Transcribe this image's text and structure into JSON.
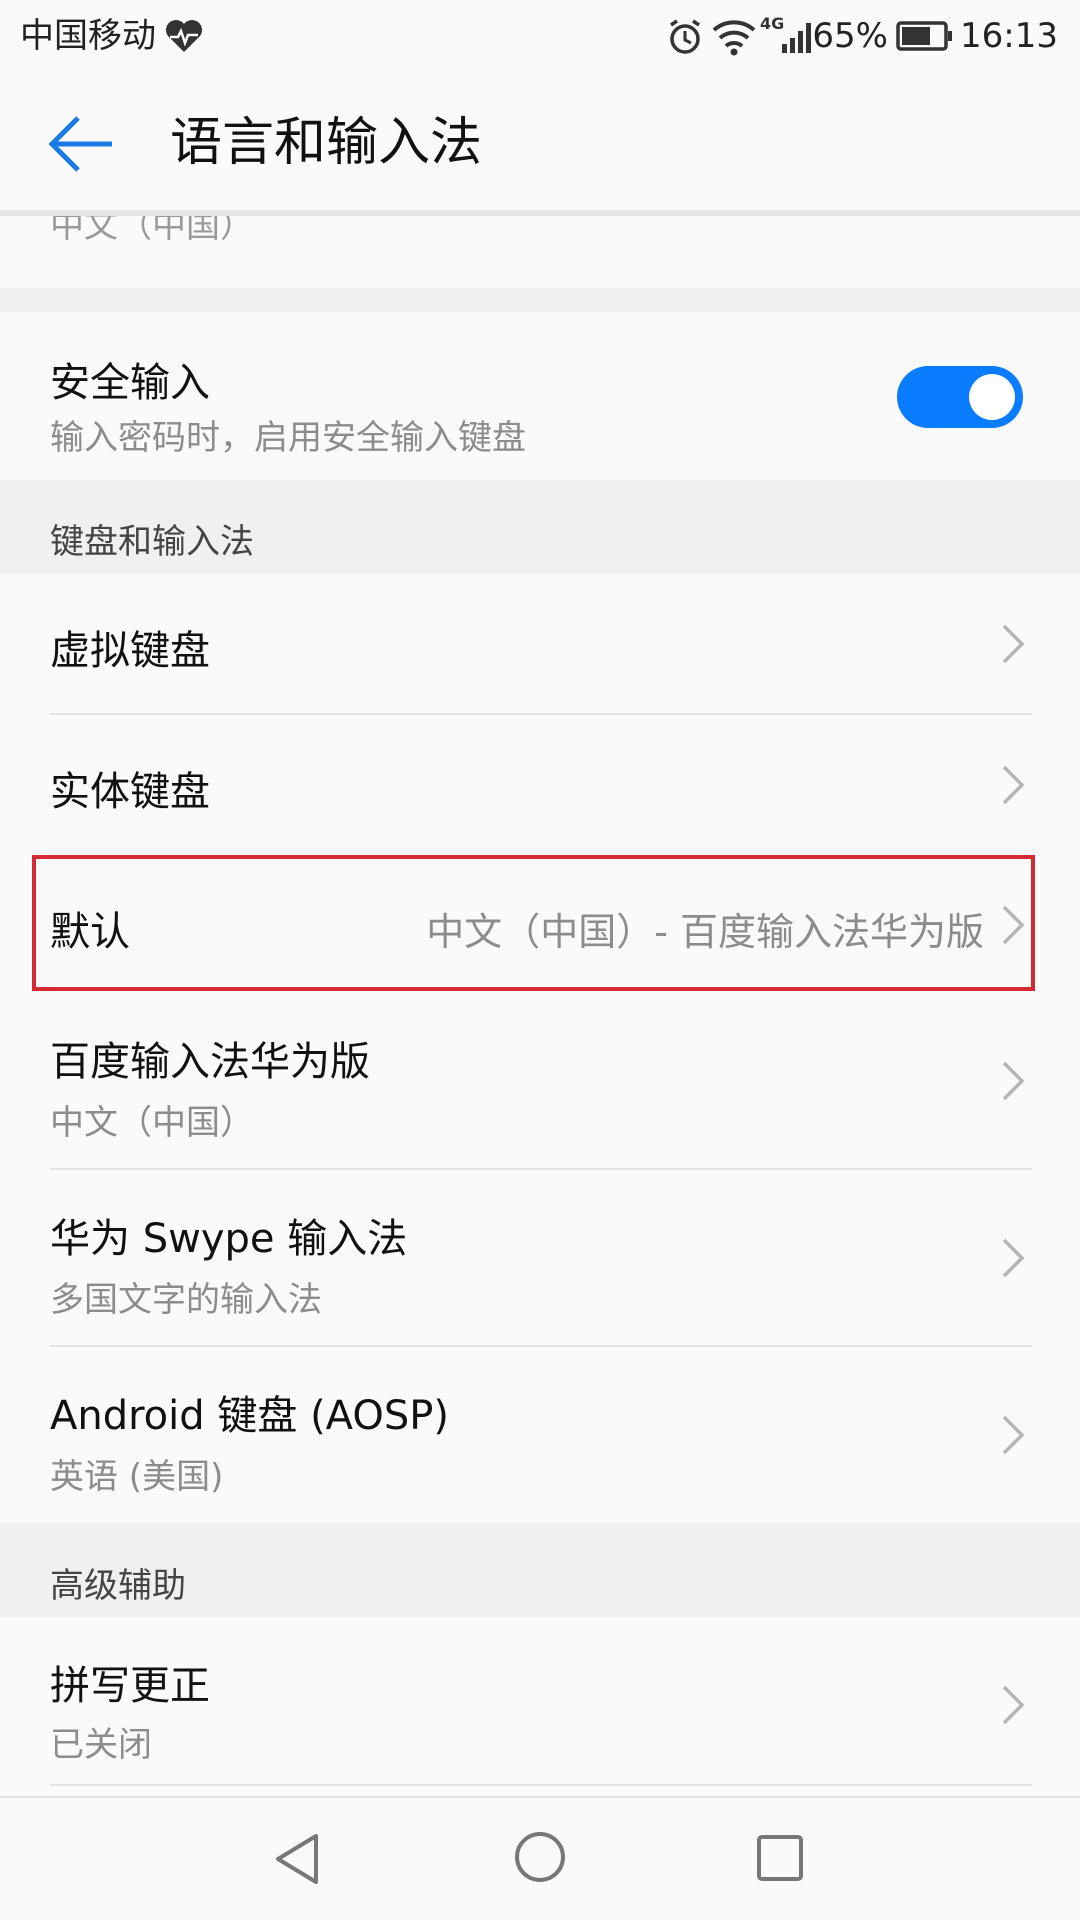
{
  "status_bar": {
    "carrier": "中国移动",
    "network": "4G",
    "battery_percent": "65%",
    "time": "16:13",
    "icons": [
      "heart-icon",
      "alarm-icon",
      "wifi-icon",
      "signal-icon",
      "battery-icon"
    ]
  },
  "app_bar": {
    "title": "语言和输入法",
    "back_icon": "back-arrow-icon"
  },
  "partial_item": {
    "text": "中文（中国）"
  },
  "secure_input": {
    "title": "安全输入",
    "subtitle": "输入密码时，启用安全输入键盘",
    "enabled": true,
    "accent_color": "#0a7cff"
  },
  "sections": {
    "keyboard_header": "键盘和输入法",
    "advanced_header": "高级辅助"
  },
  "items": {
    "virtual_keyboard": {
      "title": "虚拟键盘"
    },
    "physical_keyboard": {
      "title": "实体键盘"
    },
    "default": {
      "title": "默认",
      "value": "中文（中国）- 百度输入法华为版"
    },
    "baidu": {
      "title": "百度输入法华为版",
      "subtitle": "中文（中国）"
    },
    "swype": {
      "title": "华为 Swype 输入法",
      "subtitle": "多国文字的输入法"
    },
    "aosp": {
      "title": "Android 键盘 (AOSP)",
      "subtitle": "英语 (美国)"
    },
    "spellcheck": {
      "title": "拼写更正",
      "subtitle": "已关闭"
    }
  },
  "highlight_color": "#d42a33",
  "nav_bar": {
    "icons": [
      "nav-back-icon",
      "nav-home-icon",
      "nav-recents-icon"
    ]
  }
}
